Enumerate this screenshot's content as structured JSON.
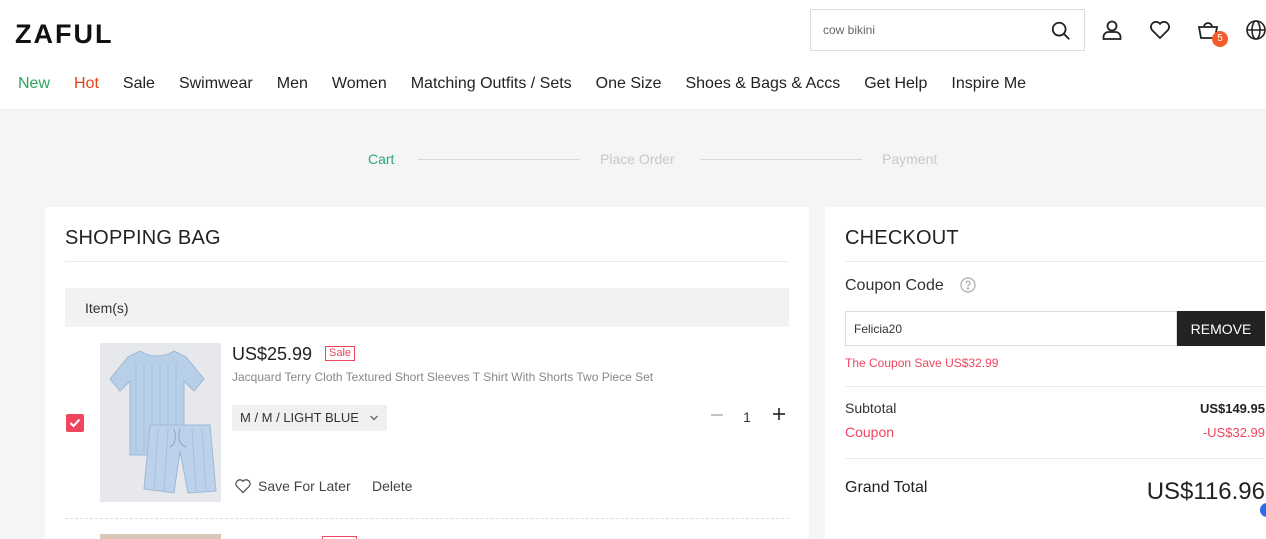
{
  "header": {
    "logo": "ZAFUL",
    "search_value": "cow bikini",
    "cart_count": "5",
    "icons": [
      "search-icon",
      "user-icon",
      "heart-icon",
      "cart-icon",
      "globe-icon"
    ]
  },
  "nav": [
    {
      "label": "New"
    },
    {
      "label": "Hot"
    },
    {
      "label": "Sale"
    },
    {
      "label": "Swimwear"
    },
    {
      "label": "Men"
    },
    {
      "label": "Women"
    },
    {
      "label": "Matching Outfits / Sets"
    },
    {
      "label": "One Size"
    },
    {
      "label": "Shoes & Bags & Accs"
    },
    {
      "label": "Get Help"
    },
    {
      "label": "Inspire Me"
    }
  ],
  "colors": {
    "new": "#2aa65f",
    "hot": "#e0451a",
    "accent": "#f0455f",
    "step_active": "#2aa685"
  },
  "steps": [
    "Cart",
    "Place Order",
    "Payment"
  ],
  "bag": {
    "title": "SHOPPING BAG",
    "items_header": "Item(s)",
    "item": {
      "price": "US$25.99",
      "badge": "Sale",
      "name": "Jacquard Terry Cloth Textured Short Sleeves T Shirt With Shorts Two Piece Set",
      "variant": "M / M / LIGHT BLUE",
      "quantity": "1",
      "save_later": "Save For Later",
      "delete": "Delete",
      "checked": true
    }
  },
  "checkout": {
    "title": "CHECKOUT",
    "coupon_label": "Coupon Code",
    "coupon_value": "Felicia20",
    "remove_label": "REMOVE",
    "coupon_message": "The Coupon Save US$32.99",
    "subtotal_label": "Subtotal",
    "subtotal_value": "US$149.95",
    "coupon_row_label": "Coupon",
    "coupon_row_value": "-US$32.99",
    "grand_total_label": "Grand Total",
    "grand_total_value": "US$116.96"
  }
}
